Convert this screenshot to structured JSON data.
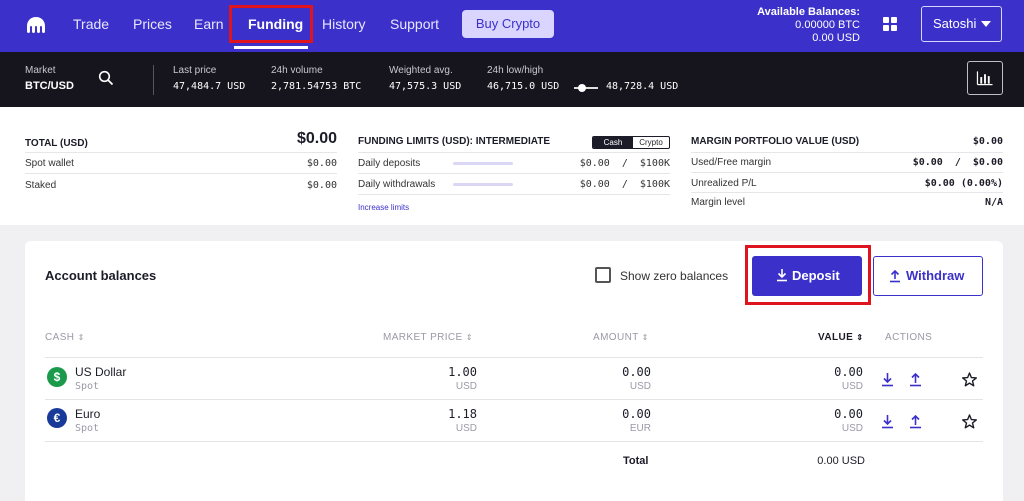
{
  "nav": {
    "items": [
      "Trade",
      "Prices",
      "Earn",
      "Funding",
      "History",
      "Support"
    ],
    "active": "Funding",
    "buy_label": "Buy Crypto",
    "available_label": "Available Balances:",
    "available_btc": "0.00000 BTC",
    "available_usd": "0.00 USD",
    "user_name": "Satoshi",
    "icons": {
      "logo": "kraken-logo-icon",
      "apps": "grid-icon",
      "user_menu": "chevron-down-icon"
    }
  },
  "ticker": {
    "market_label": "Market",
    "market_pair": "BTC/USD",
    "last_price_label": "Last price",
    "last_price": "47,484.7 USD",
    "volume_label": "24h volume",
    "volume": "2,781.54753 BTC",
    "weighted_label": "Weighted avg.",
    "weighted": "47,575.3 USD",
    "lowhigh_label": "24h low/high",
    "low": "46,715.0 USD",
    "high": "48,728.4 USD",
    "icons": {
      "search": "search-icon",
      "chart": "bar-chart-icon"
    }
  },
  "summary": {
    "total_label": "TOTAL (USD)",
    "total_value": "$0.00",
    "spot_label": "Spot wallet",
    "spot_value": "$0.00",
    "staked_label": "Staked",
    "staked_value": "$0.00",
    "limits_label": "FUNDING LIMITS (USD): INTERMEDIATE",
    "toggle_cash": "Cash",
    "toggle_crypto": "Crypto",
    "deposits_label": "Daily deposits",
    "deposits_value": "$0.00  /  $100K",
    "withdrawals_label": "Daily withdrawals",
    "withdrawals_value": "$0.00  /  $100K",
    "increase_limits": "Increase limits",
    "margin_label": "MARGIN PORTFOLIO VALUE (USD)",
    "margin_value": "$0.00",
    "used_free_label": "Used/Free margin",
    "used_free_value": "$0.00  /  $0.00",
    "upl_label": "Unrealized P/L",
    "upl_value": "$0.00 (0.00%)",
    "margin_level_label": "Margin level",
    "margin_level_value": "N/A"
  },
  "balances": {
    "title": "Account balances",
    "show_zero_label": "Show zero balances",
    "show_zero_checked": false,
    "deposit_label": "Deposit",
    "withdraw_label": "Withdraw",
    "columns": [
      "CASH",
      "MARKET PRICE",
      "AMOUNT",
      "VALUE",
      "ACTIONS"
    ],
    "sort_active": "VALUE",
    "rows": [
      {
        "name": "US Dollar",
        "type": "Spot",
        "symbol": "$",
        "color": "#1a9a4a",
        "price": "1.00",
        "price_unit": "USD",
        "amount": "0.00",
        "amount_unit": "USD",
        "value": "0.00",
        "value_unit": "USD"
      },
      {
        "name": "Euro",
        "type": "Spot",
        "symbol": "€",
        "color": "#1a3a9a",
        "price": "1.18",
        "price_unit": "USD",
        "amount": "0.00",
        "amount_unit": "EUR",
        "value": "0.00",
        "value_unit": "USD"
      }
    ],
    "total_label": "Total",
    "total_value": "0.00 USD"
  },
  "colors": {
    "brand": "#3b30c9",
    "highlight": "#e0141e",
    "ticker_bg": "#16151d"
  }
}
